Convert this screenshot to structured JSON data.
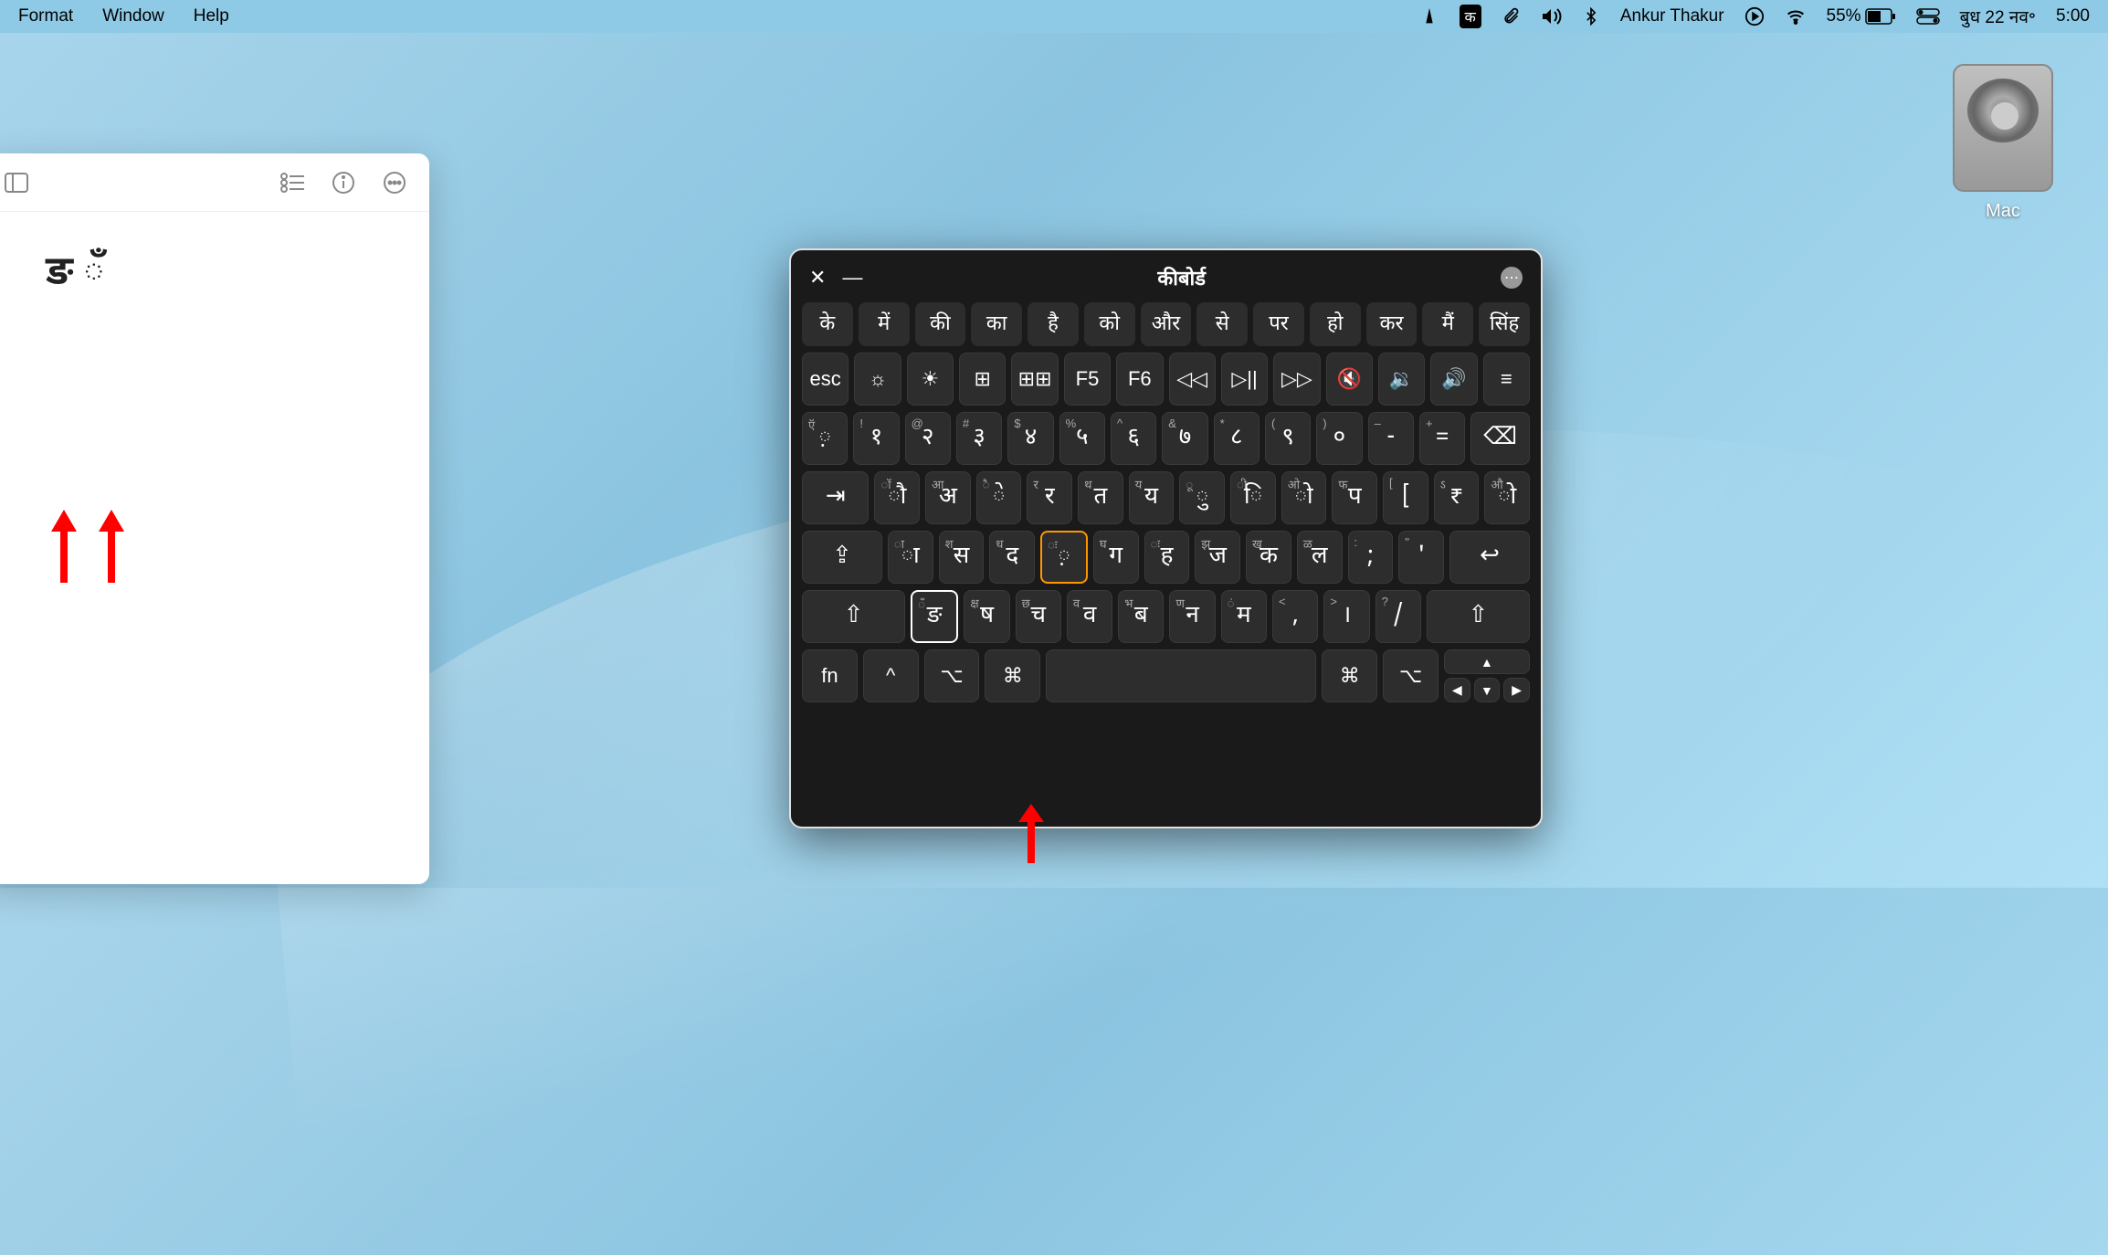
{
  "menubar": {
    "items": [
      "Format",
      "Window",
      "Help"
    ],
    "input_indicator": "क",
    "user": "Ankur Thakur",
    "battery": "55%",
    "date": "बुध 22 नव॰",
    "time": "5:00"
  },
  "notes": {
    "content": "ङ ँ"
  },
  "keyboard": {
    "title": "कीबोर्ड",
    "suggestions": [
      "के",
      "में",
      "की",
      "का",
      "है",
      "को",
      "और",
      "से",
      "पर",
      "हो",
      "कर",
      "मैं",
      "सिंह"
    ],
    "fn_row": [
      "esc",
      "☼",
      "☀",
      "⊞",
      "⊞⊞",
      "F5",
      "F6",
      "◁◁",
      "▷||",
      "▷▷",
      "🔇",
      "🔉",
      "🔊",
      "≡"
    ],
    "num_row": [
      {
        "sup": "ऍ",
        "main": "़"
      },
      {
        "sup": "!",
        "main": "१"
      },
      {
        "sup": "@",
        "main": "२"
      },
      {
        "sup": "#",
        "main": "३"
      },
      {
        "sup": "$",
        "main": "४"
      },
      {
        "sup": "%",
        "main": "५"
      },
      {
        "sup": "^",
        "main": "६"
      },
      {
        "sup": "&",
        "main": "७"
      },
      {
        "sup": "*",
        "main": "८"
      },
      {
        "sup": "(",
        "main": "९"
      },
      {
        "sup": ")",
        "main": "०"
      },
      {
        "sup": "–",
        "main": "-"
      },
      {
        "sup": "+",
        "main": "="
      },
      {
        "main": "⌫"
      }
    ],
    "row_q": [
      {
        "main": "⇥"
      },
      {
        "sup": "ॉ",
        "main": "ौ"
      },
      {
        "sup": "आ",
        "main": "अ"
      },
      {
        "sup": "ै",
        "main": "े"
      },
      {
        "sup": "र",
        "main": "र"
      },
      {
        "sup": "थ",
        "main": "त"
      },
      {
        "sup": "य",
        "main": "य"
      },
      {
        "sup": "ू",
        "main": "ु"
      },
      {
        "sup": "ी",
        "main": "ि"
      },
      {
        "sup": "ओ",
        "main": "ो"
      },
      {
        "sup": "फ",
        "main": "प"
      },
      {
        "sup": "[",
        "main": "["
      },
      {
        "sup": "ऽ",
        "main": "₹"
      },
      {
        "sup": "औ",
        "main": "ो"
      }
    ],
    "row_a": [
      {
        "main": "⇪"
      },
      {
        "sup": "ा",
        "main": "ा"
      },
      {
        "sup": "श",
        "main": "स"
      },
      {
        "sup": "ध",
        "main": "द"
      },
      {
        "sup": "ः",
        "main": "़",
        "active": "orange"
      },
      {
        "sup": "घ",
        "main": "ग"
      },
      {
        "sup": "ः",
        "main": "ह"
      },
      {
        "sup": "झ",
        "main": "ज"
      },
      {
        "sup": "ख",
        "main": "क"
      },
      {
        "sup": "ळ",
        "main": "ल"
      },
      {
        "sup": ":",
        "main": ";"
      },
      {
        "sup": "\"",
        "main": "'"
      },
      {
        "main": "↩"
      }
    ],
    "row_z": [
      {
        "main": "⇧"
      },
      {
        "sup": "ँ",
        "main": "ङ",
        "active": "white"
      },
      {
        "sup": "क्ष",
        "main": "ष"
      },
      {
        "sup": "छ",
        "main": "च"
      },
      {
        "sup": "व",
        "main": "व"
      },
      {
        "sup": "भ",
        "main": "ब"
      },
      {
        "sup": "ण",
        "main": "न"
      },
      {
        "sup": "ं",
        "main": "म"
      },
      {
        "sup": "<",
        "main": ","
      },
      {
        "sup": ">",
        "main": "।"
      },
      {
        "sup": "?",
        "main": "/"
      },
      {
        "main": "⇧"
      }
    ],
    "row_bottom": [
      "fn",
      "^",
      "⌥",
      "⌘",
      "",
      "⌘",
      "⌥"
    ]
  },
  "desktop": {
    "drive_label": "Mac"
  }
}
